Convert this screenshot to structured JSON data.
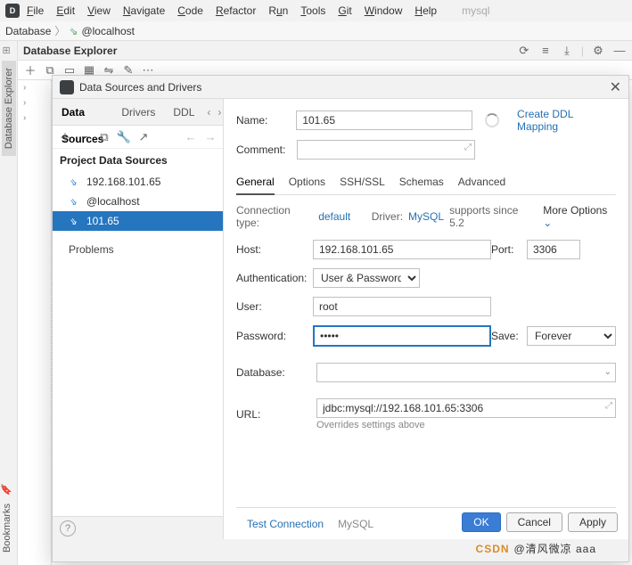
{
  "menu": {
    "items": [
      "File",
      "Edit",
      "View",
      "Navigate",
      "Code",
      "Refactor",
      "Run",
      "Tools",
      "Git",
      "Window",
      "Help"
    ],
    "project": "mysql"
  },
  "breadcrumb": {
    "root": "Database",
    "node": "@localhost"
  },
  "gutter": {
    "db": "Database Explorer",
    "bm": "Bookmarks"
  },
  "toolwin": {
    "title": "Database Explorer"
  },
  "dialog": {
    "title": "Data Sources and Drivers",
    "tabs": {
      "ds": "Data Sources",
      "drv": "Drivers",
      "ddl": "DDL"
    },
    "section": "Project Data Sources",
    "items": [
      {
        "label": "192.168.101.65"
      },
      {
        "label": "@localhost"
      },
      {
        "label": "101.65"
      }
    ],
    "problems": "Problems",
    "right": {
      "name_lbl": "Name:",
      "name": "101.65",
      "comment_lbl": "Comment:",
      "comment": "",
      "ddl_link": "Create DDL Mapping",
      "subtabs": {
        "gen": "General",
        "opt": "Options",
        "ssh": "SSH/SSL",
        "sch": "Schemas",
        "adv": "Advanced"
      },
      "ct": {
        "label": "Connection type:",
        "val": "default",
        "drv_lbl": "Driver:",
        "drv": "MySQL",
        "supp": "supports since 5.2",
        "more": "More Options"
      },
      "host_lbl": "Host:",
      "host": "192.168.101.65",
      "port_lbl": "Port:",
      "port": "3306",
      "auth_lbl": "Authentication:",
      "auth_val": "User & Password",
      "user_lbl": "User:",
      "user": "root",
      "pwd_lbl": "Password:",
      "pwd": "•••••",
      "save_lbl": "Save:",
      "save_val": "Forever",
      "db_lbl": "Database:",
      "url_lbl": "URL:",
      "url": "jdbc:mysql://192.168.101.65:3306",
      "url_hint": "Overrides settings above",
      "test": "Test Connection",
      "drv_foot": "MySQL",
      "ok": "OK",
      "cancel": "Cancel",
      "apply": "Apply"
    }
  },
  "watermark": {
    "brand": "CSDN",
    "author": "@清风微凉 aaa"
  }
}
